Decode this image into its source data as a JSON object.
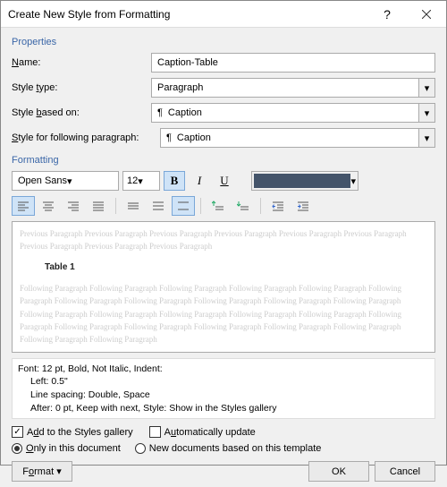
{
  "title": "Create New Style from Formatting",
  "properties": {
    "section": "Properties",
    "name_label_pre": "",
    "name_label_u": "N",
    "name_label_post": "ame:",
    "name_value": "Caption-Table",
    "type_label": "Style type:",
    "type_value": "Paragraph",
    "based_label": "Style based on:",
    "based_value": "Caption",
    "following_label": "Style for following paragraph:",
    "following_value": "Caption"
  },
  "formatting": {
    "section": "Formatting",
    "font": "Open Sans",
    "size": "12",
    "bold": "B",
    "italic": "I",
    "underline": "U",
    "color": "#44546a"
  },
  "preview": {
    "ghost_prev": "Previous Paragraph Previous Paragraph Previous Paragraph Previous Paragraph Previous Paragraph Previous Paragraph Previous Paragraph Previous Paragraph Previous Paragraph",
    "sample": "Table 1",
    "ghost_next": "Following Paragraph Following Paragraph Following Paragraph Following Paragraph Following Paragraph Following Paragraph Following Paragraph Following Paragraph Following Paragraph Following Paragraph Following Paragraph Following Paragraph Following Paragraph Following Paragraph Following Paragraph Following Paragraph Following Paragraph Following Paragraph Following Paragraph Following Paragraph Following Paragraph Following Paragraph Following Paragraph Following Paragraph"
  },
  "desc": {
    "line1": "Font: 12 pt, Bold, Not Italic, Indent:",
    "line2": "Left:  0.5\"",
    "line3": "Line spacing:  Double, Space",
    "line4": "After:  0 pt, Keep with next, Style: Show in the Styles gallery"
  },
  "options": {
    "add_gallery": "Add to the Styles gallery",
    "auto_update": "Automatically update",
    "only_doc": "Only in this document",
    "new_docs": "New documents based on this template"
  },
  "footer": {
    "format": "Format",
    "ok": "OK",
    "cancel": "Cancel"
  }
}
